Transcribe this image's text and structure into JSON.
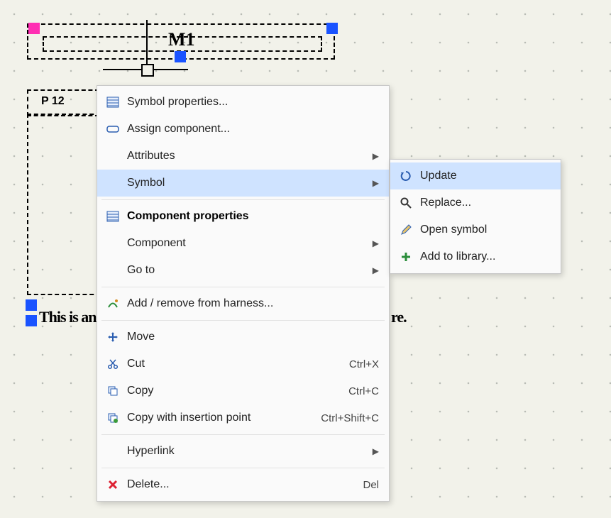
{
  "symbol": {
    "designator": "M1",
    "pin_label": "P 12",
    "caption_fragment_left": "This is an",
    "caption_fragment_right": "re."
  },
  "context_menu": {
    "items": [
      {
        "id": "symbol_properties",
        "label": "Symbol properties...",
        "icon": "properties",
        "submenu": false
      },
      {
        "id": "assign_component",
        "label": "Assign component...",
        "icon": "assign",
        "submenu": false
      },
      {
        "id": "attributes",
        "label": "Attributes",
        "icon": "",
        "submenu": true
      },
      {
        "id": "symbol",
        "label": "Symbol",
        "icon": "",
        "submenu": true,
        "hover": true
      },
      {
        "id": "component_props",
        "label": "Component properties",
        "icon": "properties",
        "submenu": false,
        "bold": true
      },
      {
        "id": "component",
        "label": "Component",
        "icon": "",
        "submenu": true
      },
      {
        "id": "goto",
        "label": "Go to",
        "icon": "",
        "submenu": true
      },
      {
        "id": "harness",
        "label": "Add / remove from harness...",
        "icon": "harness",
        "submenu": false
      },
      {
        "id": "move",
        "label": "Move",
        "icon": "move",
        "submenu": false
      },
      {
        "id": "cut",
        "label": "Cut",
        "icon": "cut",
        "shortcut": "Ctrl+X"
      },
      {
        "id": "copy",
        "label": "Copy",
        "icon": "copy",
        "shortcut": "Ctrl+C"
      },
      {
        "id": "copy_ip",
        "label": "Copy with insertion point",
        "icon": "copy2",
        "shortcut": "Ctrl+Shift+C"
      },
      {
        "id": "hyperlink",
        "label": "Hyperlink",
        "icon": "",
        "submenu": true
      },
      {
        "id": "delete",
        "label": "Delete...",
        "icon": "delete",
        "shortcut": "Del"
      }
    ]
  },
  "submenu_symbol": {
    "items": [
      {
        "id": "update",
        "label": "Update",
        "icon": "refresh",
        "hover": true
      },
      {
        "id": "replace",
        "label": "Replace...",
        "icon": "search"
      },
      {
        "id": "open",
        "label": "Open symbol",
        "icon": "pencil"
      },
      {
        "id": "addlib",
        "label": "Add to library...",
        "icon": "plus"
      }
    ]
  }
}
